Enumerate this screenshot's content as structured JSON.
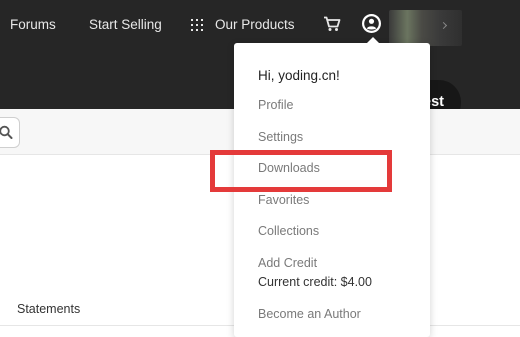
{
  "nav": {
    "forums": "Forums",
    "start_selling": "Start Selling",
    "our_products": "Our Products",
    "cart_icon": "cart-icon",
    "user_icon": "user-circle-icon",
    "grid_icon": "grid-icon"
  },
  "hero": {
    "button_label_visible": "est"
  },
  "search": {
    "icon": "search-icon"
  },
  "main": {
    "statements_label": "Statements"
  },
  "dropdown": {
    "greeting": "Hi, yoding.cn!",
    "items": [
      {
        "label": "Profile"
      },
      {
        "label": "Settings"
      },
      {
        "label": "Downloads"
      },
      {
        "label": "Favorites"
      },
      {
        "label": "Collections"
      },
      {
        "label": "Add Credit"
      },
      {
        "label": "Become an Author"
      }
    ],
    "current_credit": "Current credit: $4.00"
  },
  "colors": {
    "nav_bg": "#262626",
    "highlight": "#e43a3a",
    "menu_text": "#7a7a7a"
  }
}
